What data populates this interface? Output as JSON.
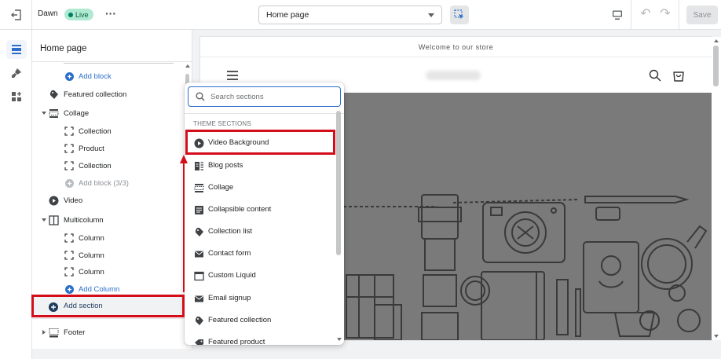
{
  "topbar": {
    "theme_name": "Dawn",
    "live_badge": "Live",
    "page_selector": "Home page",
    "save_label": "Save"
  },
  "sidebar": {
    "title": "Home page",
    "items": [
      {
        "label": "Add block",
        "icon": "plus-circle-icon"
      },
      {
        "label": "Featured collection",
        "icon": "collection-icon"
      },
      {
        "label": "Collage",
        "icon": "collage-icon"
      },
      {
        "label": "Collection",
        "icon": "block-icon"
      },
      {
        "label": "Product",
        "icon": "block-icon"
      },
      {
        "label": "Collection",
        "icon": "block-icon"
      },
      {
        "label": "Add block (3/3)",
        "icon": "plus-circle-icon"
      },
      {
        "label": "Video",
        "icon": "play-icon"
      },
      {
        "label": "Multicolumn",
        "icon": "columns-icon"
      },
      {
        "label": "Column",
        "icon": "block-icon"
      },
      {
        "label": "Column",
        "icon": "block-icon"
      },
      {
        "label": "Column",
        "icon": "block-icon"
      },
      {
        "label": "Add Column",
        "icon": "plus-circle-icon"
      },
      {
        "label": "Add section",
        "icon": "plus-circle-icon"
      },
      {
        "label": "Footer",
        "icon": "footer-icon"
      }
    ]
  },
  "popover": {
    "search_placeholder": "Search sections",
    "heading": "THEME SECTIONS",
    "items": [
      {
        "label": "Video Background",
        "icon": "play-icon"
      },
      {
        "label": "Blog posts",
        "icon": "blog-icon"
      },
      {
        "label": "Collage",
        "icon": "collage-icon"
      },
      {
        "label": "Collapsible content",
        "icon": "text-icon"
      },
      {
        "label": "Collection list",
        "icon": "collection-icon"
      },
      {
        "label": "Contact form",
        "icon": "mail-icon"
      },
      {
        "label": "Custom Liquid",
        "icon": "code-icon"
      },
      {
        "label": "Email signup",
        "icon": "mail-icon"
      },
      {
        "label": "Featured collection",
        "icon": "collection-icon"
      },
      {
        "label": "Featured product",
        "icon": "product-icon"
      }
    ]
  },
  "preview": {
    "announcement": "Welcome to our store"
  },
  "colors": {
    "accent_blue": "#2c6ecb",
    "highlight_red": "#d40d1a",
    "live_green": "#aee9d1",
    "hero_gray": "#7a7a7a"
  }
}
